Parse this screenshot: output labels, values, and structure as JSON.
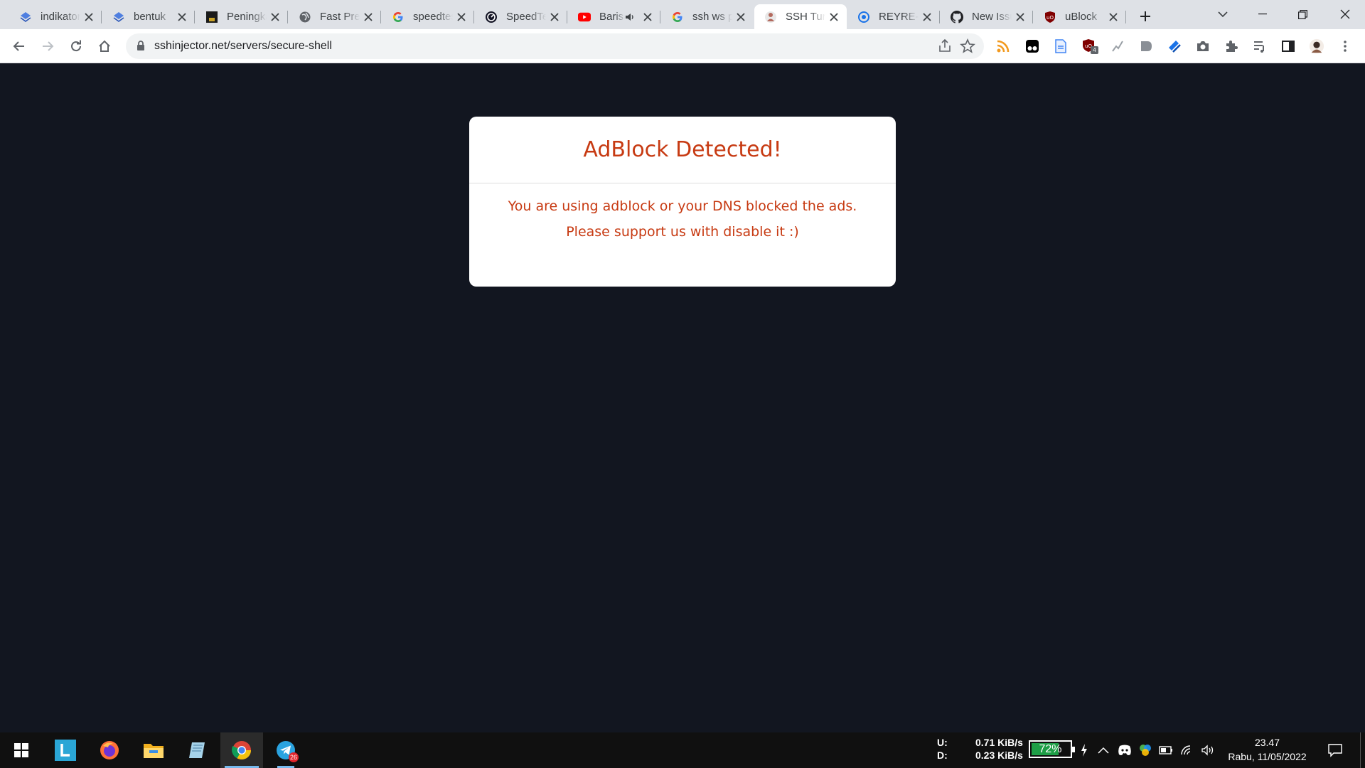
{
  "browser": {
    "tabs": [
      {
        "title": "indikator",
        "favicon": "blue-layers-icon",
        "audio": false
      },
      {
        "title": "bentuk",
        "favicon": "blue-layers-icon",
        "audio": false
      },
      {
        "title": "Peningkatan",
        "favicon": "dark-square-icon",
        "audio": false
      },
      {
        "title": "Fast Preview",
        "favicon": "globe-icon",
        "audio": false
      },
      {
        "title": "speedtest",
        "favicon": "google-icon",
        "audio": false
      },
      {
        "title": "SpeedTest",
        "favicon": "speedtest-icon",
        "audio": false
      },
      {
        "title": "Barisan",
        "favicon": "youtube-icon",
        "audio": true
      },
      {
        "title": "ssh ws port",
        "favicon": "google-icon",
        "audio": false
      },
      {
        "title": "SSH Tunnel",
        "favicon": "sshinjector-icon",
        "audio": false,
        "active": true
      },
      {
        "title": "REYRE-",
        "favicon": "shield-circle-icon",
        "audio": false
      },
      {
        "title": "New Issue",
        "favicon": "github-icon",
        "audio": false
      },
      {
        "title": "uBlock",
        "favicon": "ublock-icon",
        "audio": false
      }
    ],
    "url": "sshinjector.net/servers/secure-shell",
    "extension_badge": "4"
  },
  "page": {
    "modal": {
      "title": "AdBlock Detected!",
      "line1": "You are using adblock or your DNS blocked the ads.",
      "line2": "Please support us with disable it :)",
      "accent_color": "#c73a12"
    },
    "background_color": "#121620"
  },
  "taskbar": {
    "apps": [
      "start-icon",
      "launcher-l-icon",
      "firefox-icon",
      "file-explorer-icon",
      "notepad-icon",
      "chrome-icon",
      "telegram-icon"
    ],
    "telegram_badge": "26",
    "net_upload_label": "U:",
    "net_download_label": "D:",
    "net_upload": "0.71 KiB/s",
    "net_download": "0.23 KiB/s",
    "battery_percent": "72%",
    "battery_level": 0.72,
    "time": "23.47",
    "date": "Rabu, 11/05/2022"
  }
}
